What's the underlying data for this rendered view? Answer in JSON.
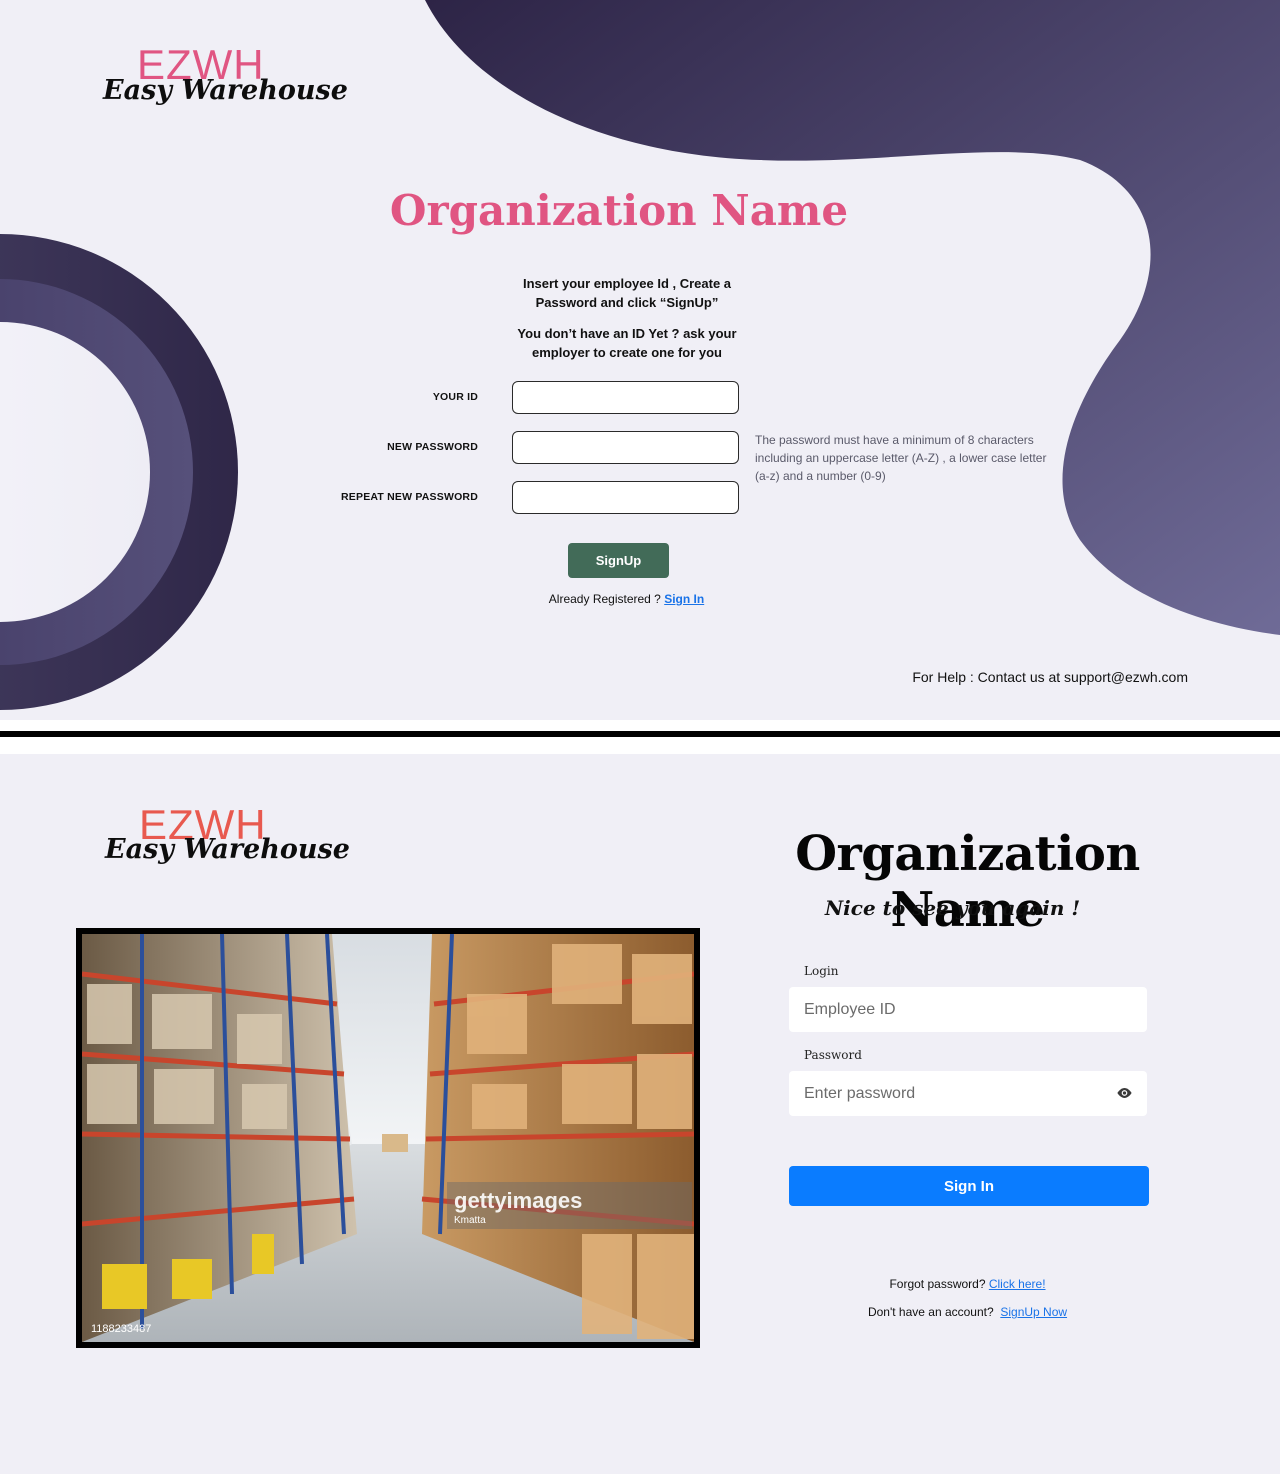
{
  "brand": {
    "name": "EZWH",
    "subtitle": "Easy Warehouse"
  },
  "colors": {
    "panel_bg": "#f0eff6",
    "blob_dark": "#2d2446",
    "blob_light": "#6d6994",
    "signup_org_title": "#e05582",
    "logo_top": "#e05582",
    "logo_bottom": "#e8594f",
    "signup_button": "#426b58",
    "signin_button": "#0a7cff",
    "link": "#1a73e8"
  },
  "signup": {
    "org_name": "Organization Name",
    "instructions_line1": "Insert your employee Id , Create a Password and click “SignUp”",
    "instructions_line2": "You don’t have an ID Yet ? ask your employer to create one for you",
    "fields": [
      {
        "label": "YOUR ID",
        "value": ""
      },
      {
        "label": "NEW PASSWORD",
        "value": ""
      },
      {
        "label": "REPEAT NEW PASSWORD",
        "value": ""
      }
    ],
    "password_hint": "The password must have a minimum of 8 characters including an uppercase letter (A-Z) , a lower case letter (a-z) and a number (0-9)",
    "button_label": "SignUp",
    "already_registered": "Already Registered ?",
    "sign_in_link": "Sign In",
    "help_text": "For Help : Contact us at support@ezwh.com"
  },
  "signin": {
    "org_name": "Organization Name",
    "welcome": "Nice to see you again !",
    "login_label": "Login",
    "login_placeholder": "Employee ID",
    "password_label": "Password",
    "password_placeholder": "Enter password",
    "button_label": "Sign In",
    "forgot_text": "Forgot password?",
    "forgot_link": "Click here!",
    "no_account_text": "Don't have an account?",
    "signup_link": "SignUp Now",
    "image": {
      "watermark_brand": "gettyimages",
      "watermark_credit": "Kmatta",
      "image_id": "1188233487"
    },
    "icons": [
      "eye-icon"
    ]
  }
}
